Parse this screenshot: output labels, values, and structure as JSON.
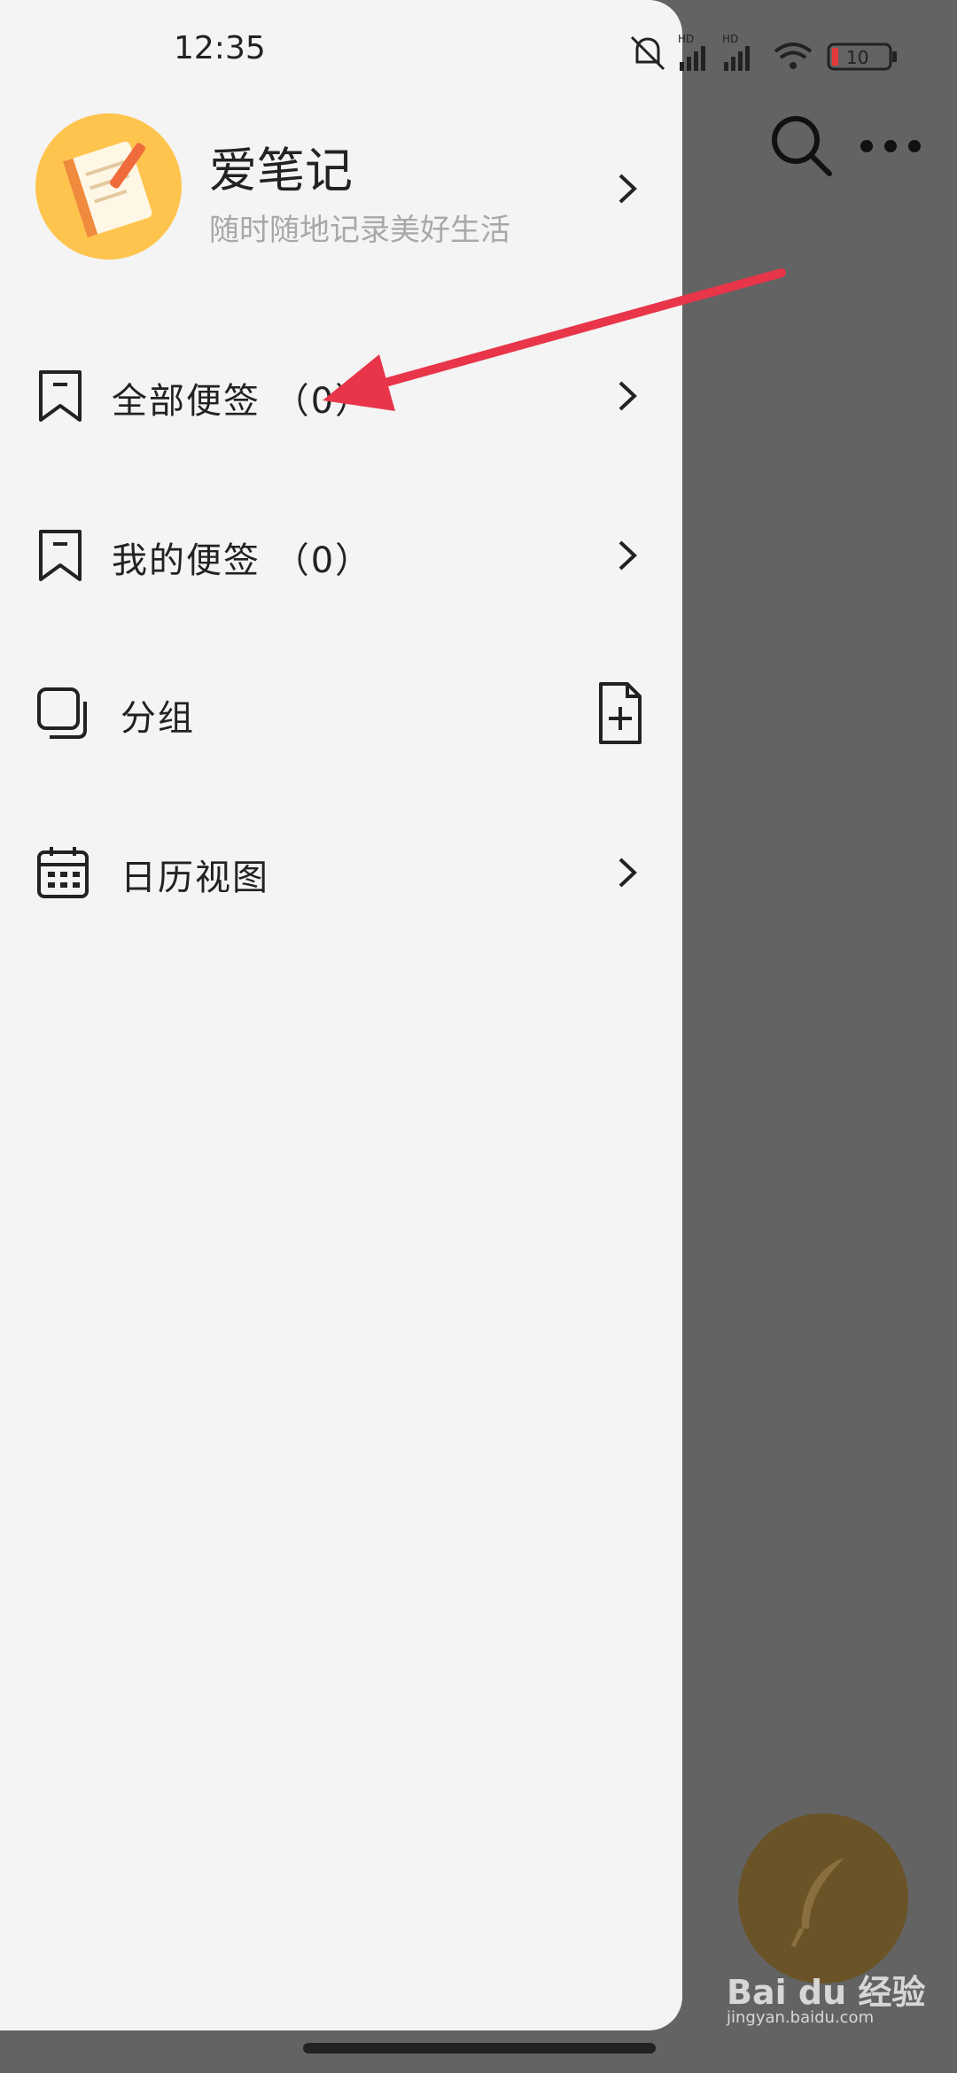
{
  "status_bar": {
    "time": "12:35",
    "battery": "10",
    "network_badge_1": "HD",
    "network_badge_2": "HD"
  },
  "profile": {
    "app_name": "爱笔记",
    "tagline": "随时随地记录美好生活"
  },
  "menu": {
    "items": [
      {
        "label": "全部便签 （0）",
        "icon": "bookmark-icon"
      },
      {
        "label": "我的便签 （0）",
        "icon": "bookmark-icon"
      },
      {
        "label": "分组",
        "icon": "folder-stack-icon"
      },
      {
        "label": "日历视图",
        "icon": "calendar-icon"
      }
    ]
  },
  "watermark": {
    "brand": "Bai du 经验",
    "url": "jingyan.baidu.com"
  },
  "colors": {
    "drawer_bg": "#f4f4f4",
    "overlay": "#636363",
    "accent_avatar": "#ffc44d",
    "annotation_arrow": "#e8354a"
  }
}
